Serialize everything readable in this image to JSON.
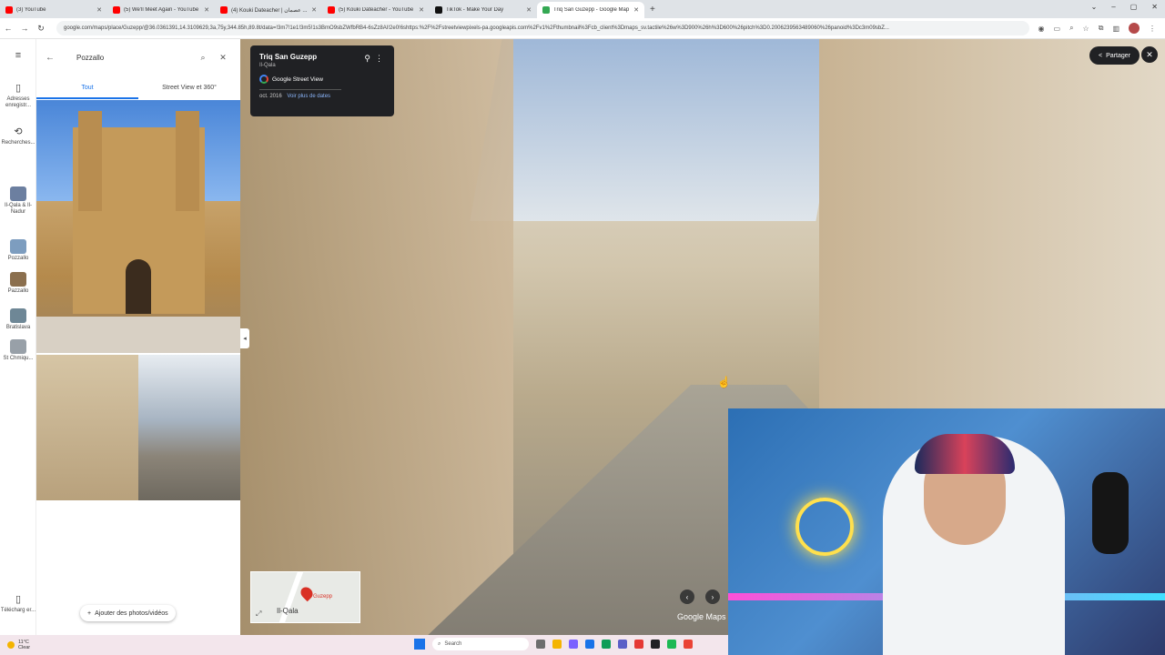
{
  "browser": {
    "tabs": [
      {
        "title": "(3) YouTube",
        "color": "#ff0000",
        "active": false
      },
      {
        "title": "(5) We'll Meet Again - YouTube",
        "color": "#ff0000",
        "active": false
      },
      {
        "title": "(4) Kouki Dateacher | عصمان ...",
        "color": "#ff0000",
        "active": false
      },
      {
        "title": "(5) Kouki Dateacher - YouTube",
        "color": "#ff0000",
        "active": false
      },
      {
        "title": "TikTok - Make Your Day",
        "color": "#111111",
        "active": false
      },
      {
        "title": "Triq San Guzepp - Google Map",
        "color": "#34a853",
        "active": true
      }
    ],
    "new_tab": "+",
    "window_controls": [
      "–",
      "▢",
      "✕"
    ],
    "window_controls_extra": "⌄",
    "url": "google.com/maps/place/Guzepp/@36.0361391,14.3109629,3a,75y,344.85h,89.8t/data=!3m7!1e1!3m5!1s3BmO9sbZWfbRB4-6sZz8AI!2e0!6shttps:%2F%2Fstreetviewpixels-pa.googleapis.com%2Fv1%2Fthumbnail%3Fcb_client%3Dmaps_sv.tactile%26w%3D900%26h%3D600%26pitch%3D0.2006239563489060%26panoid%3Dc3m09sbZ..."
  },
  "rail": {
    "menu_icon": "≡",
    "items": [
      {
        "label": "Adresses enregistr...",
        "icon": "bookmark-icon",
        "glyph": "▯"
      },
      {
        "label": "Recherches...",
        "icon": "history-icon",
        "glyph": "⟲"
      },
      {
        "label": "Il-Qala & Il-Nadur",
        "thumb": "#6c7fa0"
      },
      {
        "label": "Pozzallo",
        "thumb": "#7d9dbf"
      },
      {
        "label": "Pazzallo",
        "thumb": "#8b6f4e"
      },
      {
        "label": "Bratislava",
        "thumb": "#6e8796"
      },
      {
        "label": "St Chmiqu...",
        "thumb": "#98a0a8"
      },
      {
        "label": "Télécharg er...",
        "icon": "phone-icon",
        "glyph": "▯"
      }
    ]
  },
  "panel": {
    "search_query": "Pozzallo",
    "tabs": [
      "Tout",
      "Street View et 360°"
    ],
    "add_photos": "Ajouter des photos/vidéos"
  },
  "streetview": {
    "title": "Triq San Guzepp",
    "subtitle": "Il-Qala",
    "brand": "Google Street View",
    "date": "oct. 2016",
    "more_dates": "Voir plus de dates",
    "share": "Partager",
    "close": "✕",
    "minimap_label": "Il-Qala",
    "minimap_pin_label": "Guzepp",
    "watermark": "Google Maps",
    "prev": "‹",
    "next": "›"
  },
  "taskbar": {
    "temp": "11°C",
    "condition": "Clear",
    "search_placeholder": "Search",
    "apps": [
      "#6d6d6d",
      "#f4b400",
      "#7b61ff",
      "#1a73e8",
      "#0f9d58",
      "#5b5fc7",
      "#e53935",
      "#202124",
      "#1db954",
      "#ea4335"
    ]
  }
}
